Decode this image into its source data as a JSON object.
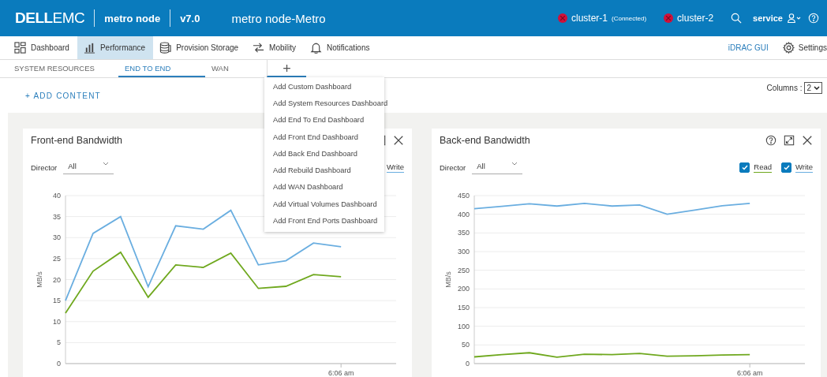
{
  "header": {
    "logo_bold": "DELL",
    "logo_light": "EMC",
    "product": "metro node",
    "version": "v7.0",
    "system": "metro node-Metro",
    "clusters": [
      {
        "name": "cluster-1",
        "note": "(Connected)",
        "color": "#d0103a"
      },
      {
        "name": "cluster-2",
        "color": "#d0103a"
      }
    ],
    "user": "service"
  },
  "nav": {
    "items": [
      {
        "label": "Dashboard",
        "selected": false
      },
      {
        "label": "Performance",
        "selected": true
      },
      {
        "label": "Provision Storage",
        "selected": false
      },
      {
        "label": "Mobility",
        "selected": false
      },
      {
        "label": "Notifications",
        "selected": false
      }
    ],
    "link": "iDRAC GUI",
    "settings": "Settings"
  },
  "tabs": [
    {
      "label": "SYSTEM RESOURCES",
      "selected": false
    },
    {
      "label": "END TO END",
      "selected": true
    },
    {
      "label": "WAN",
      "selected": false
    }
  ],
  "add_tab": {
    "label": "+"
  },
  "add_menu": {
    "items": [
      "Add Custom Dashboard",
      "Add System Resources Dashboard",
      "Add End To End Dashboard",
      "Add Front End Dashboard",
      "Add Back End Dashboard",
      "Add Rebuild Dashboard",
      "Add WAN Dashboard",
      "Add Virtual Volumes Dashboard",
      "Add Front End Ports Dashboard"
    ]
  },
  "toolbar": {
    "add_content": "+ ADD CONTENT",
    "columns_label": "Columns :",
    "columns_value": "2"
  },
  "cards": [
    {
      "title": "Front-end Bandwidth",
      "director_label": "Director",
      "director_value": "All",
      "legend": [
        {
          "label": "Write",
          "color": "#6aaee0"
        }
      ],
      "chart_data": {
        "type": "line",
        "ylabel": "MB/s",
        "categories": [
          null,
          null,
          null,
          null,
          null,
          null,
          null,
          null,
          null,
          null,
          "6:06 am"
        ],
        "ylim": [
          0,
          40
        ],
        "grid": true,
        "yticks": [
          0,
          5,
          10,
          15,
          20,
          25,
          30,
          35,
          40
        ],
        "series": [
          {
            "color": "#6aaee0",
            "values": [
              15,
              31,
              35,
              18.3,
              32.8,
              32,
              36.5,
              23.5,
              24.5,
              28.7,
              27.8
            ]
          },
          {
            "color": "#6fa81e",
            "values": [
              12,
              22,
              26.5,
              15.8,
              23.5,
              22.9,
              26.3,
              17.9,
              18.4,
              21.2,
              20.7
            ]
          }
        ]
      }
    },
    {
      "title": "Back-end Bandwidth",
      "director_label": "Director",
      "director_value": "All",
      "legend": [
        {
          "label": "Read",
          "checked": true,
          "color": "#6fa81e"
        },
        {
          "label": "Write",
          "checked": true,
          "color": "#6aaee0"
        }
      ],
      "chart_data": {
        "type": "line",
        "ylabel": "MB/s",
        "categories": [
          null,
          null,
          null,
          null,
          null,
          null,
          null,
          null,
          null,
          null,
          "6:06 am"
        ],
        "ylim": [
          0,
          450
        ],
        "grid": true,
        "yticks": [
          0,
          50,
          100,
          150,
          200,
          250,
          300,
          350,
          400,
          450
        ],
        "series": [
          {
            "color": "#6aaee0",
            "values": [
              415,
              421,
              428,
              422,
              429,
              422,
              425,
              400,
              411,
              423,
              429
            ]
          },
          {
            "color": "#6fa81e",
            "values": [
              18,
              24,
              29,
              17,
              25,
              24,
              27,
              20,
              21,
              23,
              24
            ]
          }
        ]
      }
    }
  ]
}
